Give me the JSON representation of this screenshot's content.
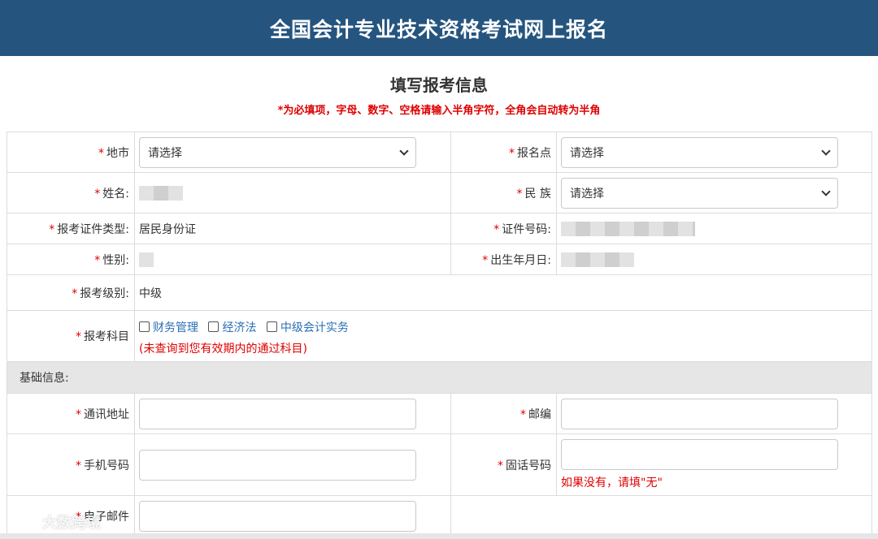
{
  "header": {
    "title": "全国会计专业技术资格考试网上报名"
  },
  "page": {
    "heading": "填写报考信息",
    "notice": "*为必填项，字母、数字、空格请输入半角字符，全角会自动转为半角"
  },
  "required_mark": "*",
  "fields": {
    "city": {
      "label": "地市",
      "value": "请选择"
    },
    "exam_site": {
      "label": "报名点",
      "value": "请选择"
    },
    "name": {
      "label": "姓名:"
    },
    "ethnicity": {
      "label": "民 族",
      "value": "请选择"
    },
    "id_type": {
      "label": "报考证件类型:",
      "value": "居民身份证"
    },
    "id_number": {
      "label": "证件号码:"
    },
    "gender": {
      "label": "性别:"
    },
    "birth_date": {
      "label": "出生年月日:"
    },
    "exam_level": {
      "label": "报考级别:",
      "value": "中级"
    },
    "subjects": {
      "label": "报考科目",
      "options": [
        "财务管理",
        "经济法",
        "中级会计实务"
      ],
      "hint": "(未查询到您有效期内的通过科目)"
    }
  },
  "basic_info": {
    "section_title": "基础信息:",
    "address": {
      "label": "通讯地址",
      "value": ""
    },
    "postcode": {
      "label": "邮编",
      "value": ""
    },
    "mobile": {
      "label": "手机号码",
      "value": ""
    },
    "landline": {
      "label": "固话号码",
      "value": "",
      "hint": "如果没有，请填\"无\""
    },
    "email": {
      "label": "电子邮件",
      "value": ""
    }
  },
  "watermark": {
    "text": "大数跨境"
  },
  "colors": {
    "header_bg": "#25557f",
    "required": "#e00000",
    "link": "#2a6fb5",
    "section_bg": "#e6e6e6"
  }
}
